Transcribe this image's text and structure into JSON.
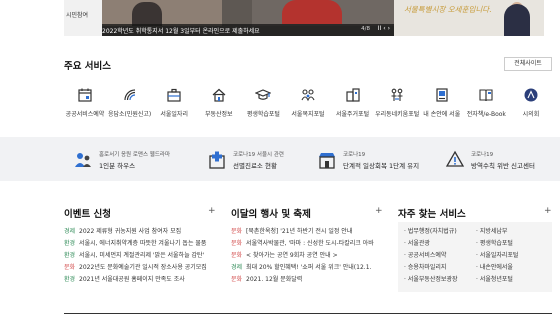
{
  "banner": {
    "left_text": "시민참여",
    "caption": "2022학년도 취학통지서 12월 3일부터 온라인으로 제출하세요",
    "page": "4/8",
    "pause": "II",
    "prev": "‹",
    "next": "›",
    "right_text": "서울특별시장 오세훈입니다."
  },
  "main_services": {
    "title": "주요 서비스",
    "all_sites": "전체사이트",
    "items": [
      {
        "label": "공공서비스예약",
        "icon": "calendar-icon"
      },
      {
        "label": "응답소(민원신고)",
        "icon": "signal-icon"
      },
      {
        "label": "서울일자리",
        "icon": "briefcase-icon"
      },
      {
        "label": "부동산정보",
        "icon": "house-icon"
      },
      {
        "label": "평생학습포털",
        "icon": "graduation-cap-icon"
      },
      {
        "label": "서울복지포털",
        "icon": "family-icon"
      },
      {
        "label": "서울주거포털",
        "icon": "apartment-icon"
      },
      {
        "label": "우리동네키움포털",
        "icon": "kids-icon"
      },
      {
        "label": "내 손안에 서울",
        "icon": "mobile-icon"
      },
      {
        "label": "전자책/e-Book",
        "icon": "book-icon"
      },
      {
        "label": "시의회",
        "icon": "council-icon"
      }
    ]
  },
  "quick_panel": [
    {
      "line1": "홈로서기 응원 로맨스 웹드라마",
      "line2": "1인분 하우스"
    },
    {
      "line1": "코로나19 서울시 관련",
      "line2": "선별진료소 현황"
    },
    {
      "line1": "코로나19",
      "line2": "단계적 일상회복 1단계 유지"
    },
    {
      "line1": "코로나19",
      "line2": "방역수칙 위반 신고센터"
    }
  ],
  "events": {
    "title": "이벤트 신청",
    "plus": "+",
    "items": [
      {
        "tag": "경제",
        "text": "2022 제류형 귀농지원 사업 참여자 모집"
      },
      {
        "tag": "환경",
        "text": "서울시, 에너지취약계층 따뜻한 겨울나기 돕는 물품"
      },
      {
        "tag": "환경",
        "text": "서울시, 미세먼지 계절관리제 '맑은 서울하늘 감탄'"
      },
      {
        "tag": "문화",
        "text": "2022년도 문화예술기관 일시적 장소사용 공기모집"
      },
      {
        "tag": "환경",
        "text": "2021년 서울대공원 홈페이지 만족도 조사"
      }
    ]
  },
  "shows": {
    "title": "이달의 행사 및 축제",
    "plus": "+",
    "items": [
      {
        "tag": "문화",
        "text": "[북촌한옥청] '21년 하반기 전시 일정 안내"
      },
      {
        "tag": "문화",
        "text": "서울역사박물관, '마마 : 신성한 도시-타칼리크 아바"
      },
      {
        "tag": "문화",
        "text": "< 찾아가는 공연 9회차 공연 안내 >"
      },
      {
        "tag": "경제",
        "text": "최대 20% 할인혜택! '쇼퍼 서울 위크' 안내(12.1."
      },
      {
        "tag": "문화",
        "text": "2021. 12월 문화달력"
      }
    ]
  },
  "faq_services": {
    "title": "자주 찾는 서비스",
    "plus": "+",
    "left": [
      "· 법무행정(자치법규)",
      "· 서울관광",
      "· 공공서비스예약",
      "· 승용차마일리지",
      "· 서울부동산정보광장"
    ],
    "right": [
      "· 지방세납부",
      "· 평생학습포털",
      "· 서울일자리포털",
      "· 내손안에서울",
      "· 서울청년포털"
    ]
  }
}
